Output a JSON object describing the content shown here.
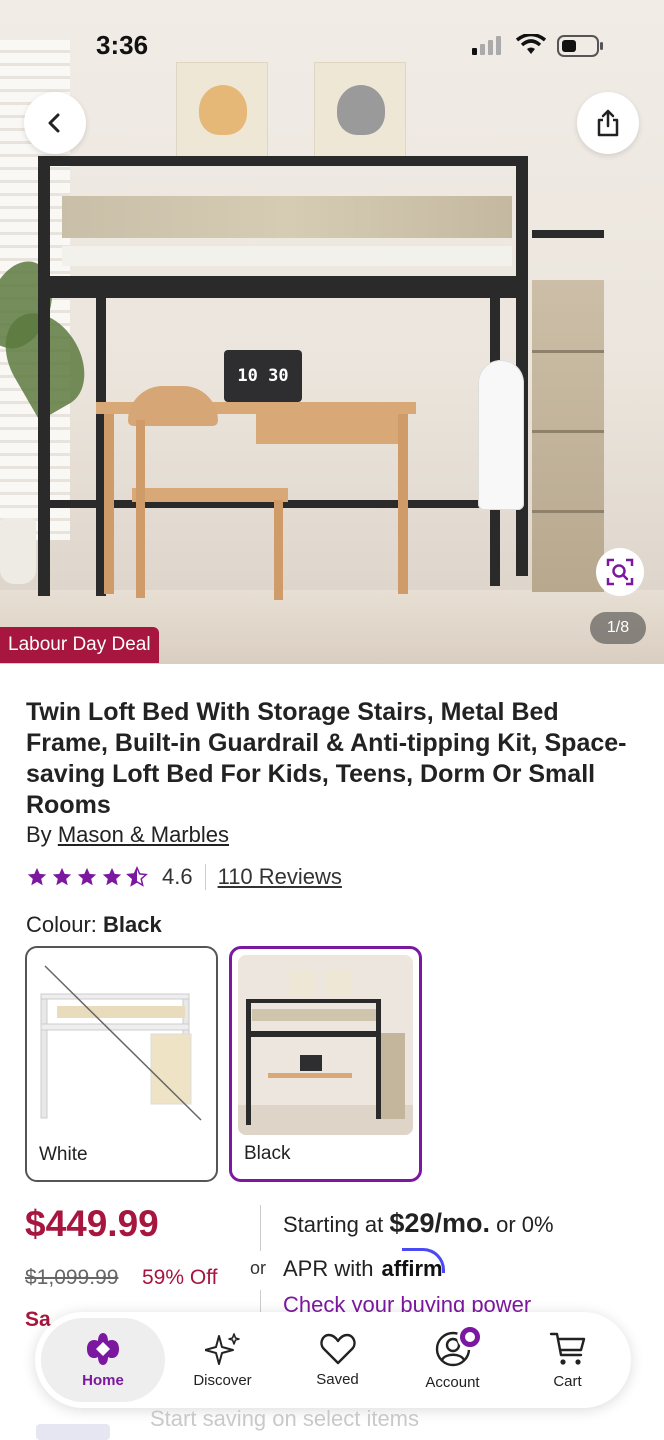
{
  "status_bar": {
    "time": "3:36"
  },
  "gallery": {
    "deal_tag": "Labour Day Deal",
    "counter": "1/8",
    "laptop_clock": "10 30"
  },
  "product": {
    "title": "Twin Loft Bed With Storage Stairs, Metal Bed Frame, Built-in Guardrail & Anti-tipping Kit, Space-saving Loft Bed For Kids, Teens, Dorm Or Small Rooms",
    "by_prefix": "By",
    "brand": "Mason & Marbles",
    "rating": "4.6",
    "stars_filled": 4.5,
    "reviews": "110 Reviews",
    "colour_label": "Colour:",
    "colour_selected": "Black",
    "swatches": [
      {
        "label": "White"
      },
      {
        "label": "Black"
      }
    ]
  },
  "pricing": {
    "price": "$449.99",
    "was": "$1,099.99",
    "off": "59% Off",
    "sale_partial": "Sa",
    "or": "or",
    "starting_at": "Starting at",
    "monthly": "$29/mo.",
    "or_zero": "or 0%",
    "apr_with": "APR with",
    "affirm": "affirm",
    "check_power": "Check your buying power"
  },
  "nav": {
    "items": [
      {
        "label": "Home"
      },
      {
        "label": "Discover"
      },
      {
        "label": "Saved"
      },
      {
        "label": "Account"
      },
      {
        "label": "Cart"
      }
    ]
  },
  "footer": {
    "promo": "Start saving on select items"
  },
  "colors": {
    "accent": "#7b189f",
    "deal": "#a6163e"
  }
}
